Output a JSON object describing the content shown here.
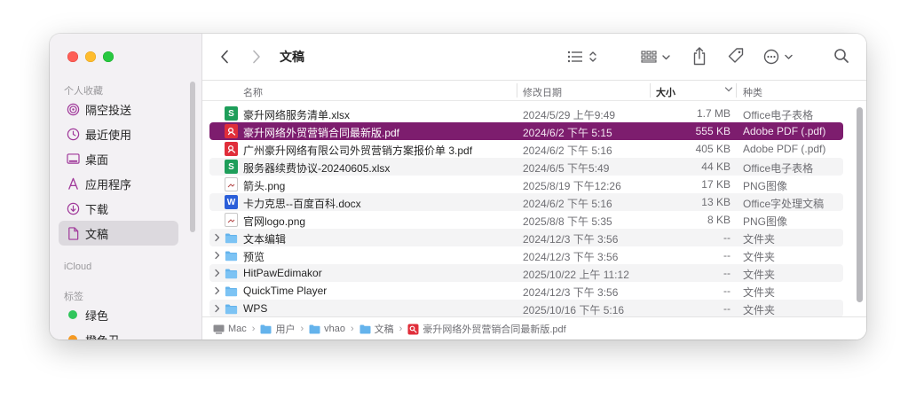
{
  "window": {
    "title": "文稿"
  },
  "sidebar": {
    "favorites_heading": "个人收藏",
    "icloud_heading": "iCloud",
    "tags_heading": "标签",
    "favorites": [
      {
        "label": "隔空投送",
        "icon": "airdrop-icon"
      },
      {
        "label": "最近使用",
        "icon": "clock-icon"
      },
      {
        "label": "桌面",
        "icon": "desktop-icon"
      },
      {
        "label": "应用程序",
        "icon": "applications-icon"
      },
      {
        "label": "下载",
        "icon": "download-icon"
      },
      {
        "label": "文稿",
        "icon": "document-icon",
        "selected": true
      }
    ],
    "tags": [
      {
        "label": "绿色",
        "color": "#2fc55b"
      },
      {
        "label": "橙色丑",
        "color": "#f59a23"
      }
    ]
  },
  "columns": {
    "name": "名称",
    "date": "修改日期",
    "size": "大小",
    "kind": "种类"
  },
  "files": [
    {
      "name": "豪升网络服务清单.xlsx",
      "date": "2024/5/29 上午9:49",
      "size": "1.7 MB",
      "kind": "Office电子表格",
      "type": "xlsx"
    },
    {
      "name": "豪升网络外贸营销合同最新版.pdf",
      "date": "2024/6/2 下午 5:15",
      "size": "555 KB",
      "kind": "Adobe PDF (.pdf)",
      "type": "pdf",
      "selected": true
    },
    {
      "name": "广州豪升网络有限公司外贸营销方案报价单 3.pdf",
      "date": "2024/6/2 下午 5:16",
      "size": "405 KB",
      "kind": "Adobe PDF (.pdf)",
      "type": "pdf"
    },
    {
      "name": "服务器续费协议-20240605.xlsx",
      "date": "2024/6/5 下午5:49",
      "size": "44 KB",
      "kind": "Office电子表格",
      "type": "xlsx"
    },
    {
      "name": "箭头.png",
      "date": "2025/8/19 下午12:26",
      "size": "17 KB",
      "kind": "PNG图像",
      "type": "png"
    },
    {
      "name": "卡力克思--百度百科.docx",
      "date": "2024/6/2 下午 5:16",
      "size": "13 KB",
      "kind": "Office字处理文稿",
      "type": "docx"
    },
    {
      "name": "官网logo.png",
      "date": "2025/8/8 下午 5:35",
      "size": "8 KB",
      "kind": "PNG图像",
      "type": "png"
    },
    {
      "name": "文本编辑",
      "date": "2024/12/3 下午 3:56",
      "size": "--",
      "kind": "文件夹",
      "type": "folder"
    },
    {
      "name": "预览",
      "date": "2024/12/3 下午 3:56",
      "size": "--",
      "kind": "文件夹",
      "type": "folder"
    },
    {
      "name": "HitPawEdimakor",
      "date": "2025/10/22 上午 11:12",
      "size": "--",
      "kind": "文件夹",
      "type": "folder"
    },
    {
      "name": "QuickTime Player",
      "date": "2024/12/3 下午 3:56",
      "size": "--",
      "kind": "文件夹",
      "type": "folder"
    },
    {
      "name": "WPS",
      "date": "2025/10/16 下午 5:16",
      "size": "--",
      "kind": "文件夹",
      "type": "folder"
    }
  ],
  "pathbar": [
    "Mac",
    "用户",
    "vhao",
    "文稿",
    "豪升网络外贸营销合同最新版.pdf"
  ],
  "colors": {
    "selection": "#7d1d6e",
    "sidebar_bg": "#f3f1f4"
  }
}
